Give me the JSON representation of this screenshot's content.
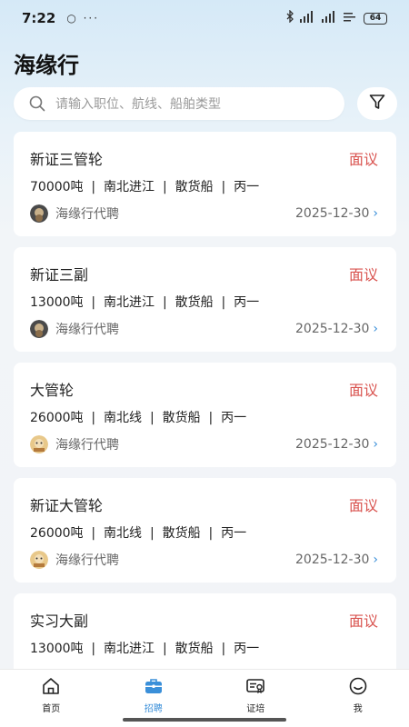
{
  "status_bar": {
    "time": "7:22",
    "dots": "○ ···",
    "battery": "64"
  },
  "app": {
    "title": "海缘行"
  },
  "search": {
    "placeholder": "请输入职位、航线、船舶类型"
  },
  "jobs": [
    {
      "title": "新证三管轮",
      "salary": "面议",
      "details": "70000吨  |  南北进江  |  散货船  |  丙一",
      "company": "海缘行代聘",
      "date": "2025-12-30",
      "avatar": "avatar-dark"
    },
    {
      "title": "新证三副",
      "salary": "面议",
      "details": "13000吨  |  南北进江  |  散货船  |  丙一",
      "company": "海缘行代聘",
      "date": "2025-12-30",
      "avatar": "avatar-dark"
    },
    {
      "title": "大管轮",
      "salary": "面议",
      "details": "26000吨  |  南北线  |  散货船  |  丙一",
      "company": "海缘行代聘",
      "date": "2025-12-30",
      "avatar": "avatar-light"
    },
    {
      "title": "新证大管轮",
      "salary": "面议",
      "details": "26000吨  |  南北线  |  散货船  |  丙一",
      "company": "海缘行代聘",
      "date": "2025-12-30",
      "avatar": "avatar-light"
    },
    {
      "title": "实习大副",
      "salary": "面议",
      "details": "13000吨  |  南北进江  |  散货船  |  丙一"
    }
  ],
  "tabs": [
    {
      "label": "首页",
      "icon": "home-icon",
      "active": false
    },
    {
      "label": "招聘",
      "icon": "briefcase-icon",
      "active": true
    },
    {
      "label": "证培",
      "icon": "certificate-icon",
      "active": false
    },
    {
      "label": "我",
      "icon": "profile-icon",
      "active": false
    }
  ],
  "colors": {
    "accent": "#3a8fd9",
    "salary": "#d9534f",
    "background_top": "#d5e9f7"
  }
}
